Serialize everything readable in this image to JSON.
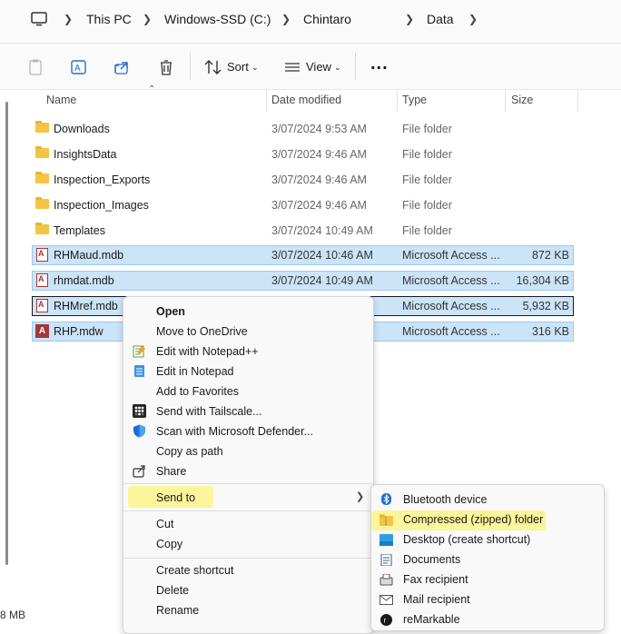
{
  "address": {
    "crumbs": [
      "This PC",
      "Windows-SSD (C:)",
      "Chintaro",
      "Data"
    ]
  },
  "toolbar": {
    "sort_label": "Sort",
    "view_label": "View",
    "more_label": "..."
  },
  "columns": [
    "Name",
    "Date modified",
    "Type",
    "Size"
  ],
  "files": [
    {
      "name": "Downloads",
      "date": "3/07/2024 9:53 AM",
      "type": "File folder",
      "size": "",
      "icon": "folder-icon"
    },
    {
      "name": "InsightsData",
      "date": "3/07/2024 9:46 AM",
      "type": "File folder",
      "size": "",
      "icon": "folder-icon"
    },
    {
      "name": "Inspection_Exports",
      "date": "3/07/2024 9:46 AM",
      "type": "File folder",
      "size": "",
      "icon": "folder-icon"
    },
    {
      "name": "Inspection_Images",
      "date": "3/07/2024 9:46 AM",
      "type": "File folder",
      "size": "",
      "icon": "folder-icon"
    },
    {
      "name": "Templates",
      "date": "3/07/2024 10:49 AM",
      "type": "File folder",
      "size": "",
      "icon": "folder-icon"
    },
    {
      "name": "RHMaud.mdb",
      "date": "3/07/2024 10:46 AM",
      "type": "Microsoft Access ...",
      "size": "872 KB",
      "icon": "access-db-icon"
    },
    {
      "name": "rhmdat.mdb",
      "date": "3/07/2024 10:49 AM",
      "type": "Microsoft Access ...",
      "size": "16,304 KB",
      "icon": "access-db-icon"
    },
    {
      "name": "RHMref.mdb",
      "date": "",
      "type": "Microsoft Access ...",
      "size": "5,932 KB",
      "icon": "access-db-icon"
    },
    {
      "name": "RHP.mdw",
      "date": "",
      "type": "Microsoft Access ...",
      "size": "316 KB",
      "icon": "access-workgroup-icon"
    }
  ],
  "context_menu": {
    "items": [
      "Open",
      "Move to OneDrive",
      "Edit with Notepad++",
      "Edit in Notepad",
      "Add to Favorites",
      "Send with Tailscale...",
      "Scan with Microsoft Defender...",
      "Copy as path",
      "Share",
      "Send to",
      "Cut",
      "Copy",
      "Create shortcut",
      "Delete",
      "Rename"
    ]
  },
  "send_to_menu": {
    "items": [
      "Bluetooth device",
      "Compressed (zipped) folder",
      "Desktop (create shortcut)",
      "Documents",
      "Fax recipient",
      "Mail recipient",
      "reMarkable"
    ]
  },
  "status": {
    "size_text": "8 MB"
  },
  "colors": {
    "selection": "#cce4f7",
    "highlight": "#fbf59c",
    "folder": "#f4c542"
  }
}
